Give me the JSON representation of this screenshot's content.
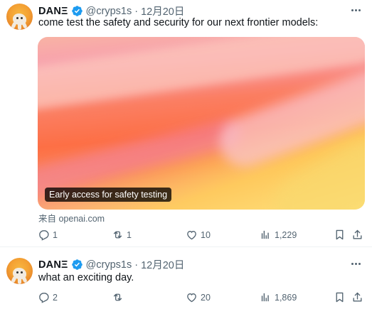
{
  "tweets": [
    {
      "author": {
        "name": "DANΞ",
        "handle": "@cryps1s",
        "date": "12月20日"
      },
      "text": "come test the safety and security for our next frontier models:",
      "media": {
        "caption": "Early access for safety testing",
        "source": "来自 openai.com"
      },
      "stats": {
        "replies": "1",
        "retweets": "1",
        "likes": "10",
        "views": "1,229"
      }
    },
    {
      "author": {
        "name": "DANΞ",
        "handle": "@cryps1s",
        "date": "12月20日"
      },
      "text": "what an exciting day.",
      "stats": {
        "replies": "2",
        "retweets": "",
        "likes": "20",
        "views": "1,869"
      }
    }
  ],
  "separator": "·",
  "icons": {
    "verified": "verified-badge-icon",
    "more": "more-dots-icon",
    "reply": "reply-icon",
    "retweet": "retweet-icon",
    "like": "heart-icon",
    "views": "views-chart-icon",
    "bookmark": "bookmark-icon",
    "share": "share-icon"
  },
  "colors": {
    "verified": "#1d9bf0",
    "secondary_text": "#536471",
    "text": "#0f1419",
    "divider": "#eff3f4"
  }
}
